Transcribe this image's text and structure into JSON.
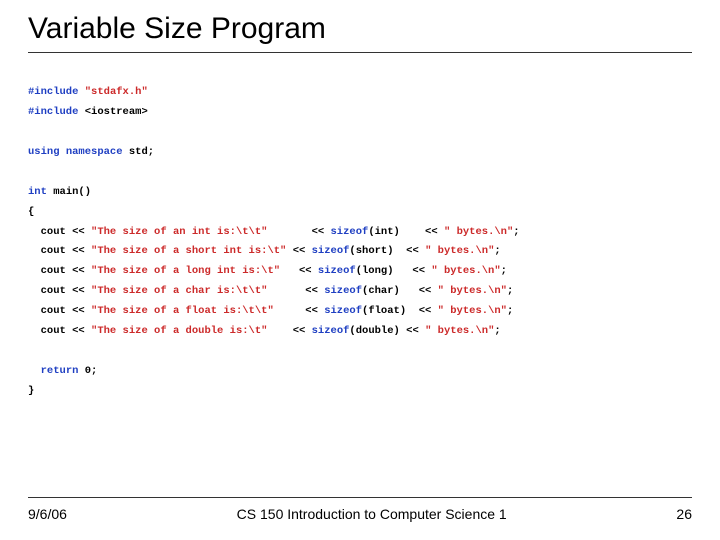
{
  "title": "Variable Size Program",
  "footer": {
    "date": "9/6/06",
    "course": "CS 150 Introduction to Computer Science 1",
    "page": "26"
  },
  "kw": {
    "include": "#include",
    "using": "using",
    "namespace": "namespace",
    "int": "int",
    "return": "return",
    "sizeof": "sizeof"
  },
  "str": {
    "hdr1": "\"stdafx.h\"",
    "s_int": "\"The size of an int is:\\t\\t\"",
    "s_short": "\"The size of a short int is:\\t\"",
    "s_long": "\"The size of a long int is:\\t\"",
    "s_char": "\"The size of a char is:\\t\\t\"",
    "s_float": "\"The size of a float is:\\t\\t\"",
    "s_double": "\"The size of a double is:\\t\"",
    "bytes": "\" bytes.\\n\""
  },
  "txt": {
    "iostream": "<iostream>",
    "std": "std;",
    "main_sig": "main()",
    "lbrace": "{",
    "rbrace": "}",
    "zero_semi": "0;",
    "cout": "cout <<",
    "ltlt": "<<",
    "semi": ";",
    "p_int": "(int)",
    "p_short": "(short)",
    "p_long": "(long)",
    "p_char": "(char)",
    "p_float": "(float)",
    "p_double": "(double)"
  }
}
